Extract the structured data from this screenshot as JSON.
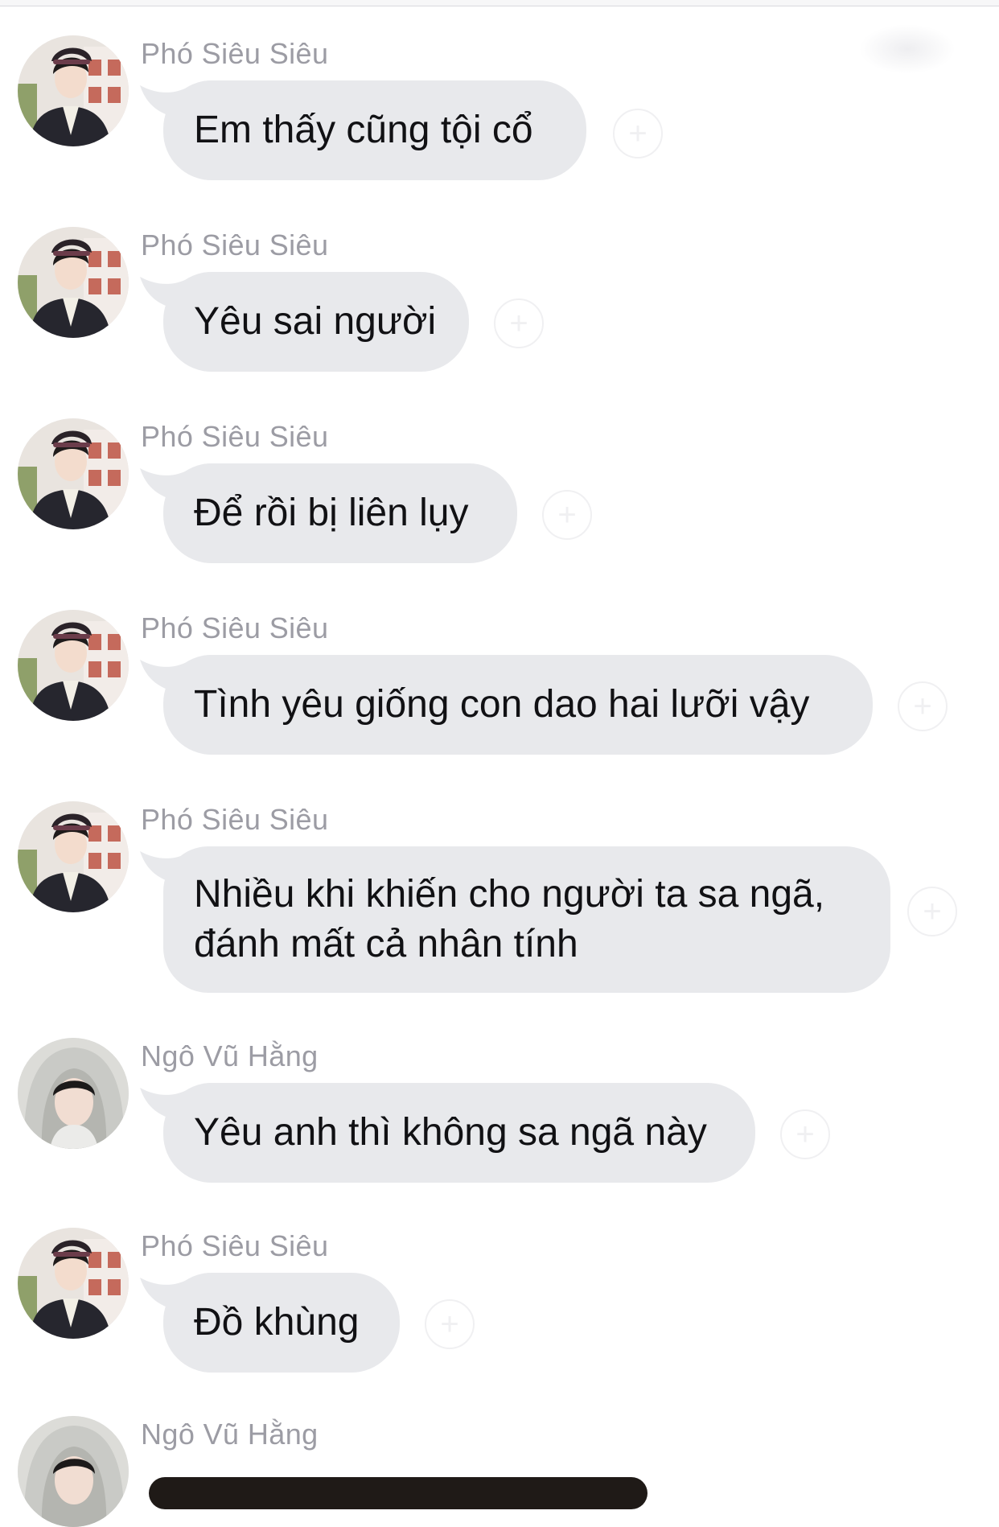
{
  "chat": {
    "messages": [
      {
        "sender": "Phó Siêu Siêu",
        "text": "Em thấy cũng tội cổ",
        "avatar_icon": "avatar-boy-cap-icon"
      },
      {
        "sender": "Phó Siêu Siêu",
        "text": "Yêu sai người",
        "avatar_icon": "avatar-boy-cap-icon"
      },
      {
        "sender": "Phó Siêu Siêu",
        "text": "Để rồi bị liên lụy",
        "avatar_icon": "avatar-boy-cap-icon"
      },
      {
        "sender": "Phó Siêu Siêu",
        "text": "Tình yêu giống con dao hai lưỡi vậy",
        "avatar_icon": "avatar-boy-cap-icon"
      },
      {
        "sender": "Phó Siêu Siêu",
        "text_lines": [
          "Nhiều khi khiến cho người ta sa ngã,",
          "đánh mất cả nhân tính"
        ],
        "avatar_icon": "avatar-boy-cap-icon"
      },
      {
        "sender": "Ngô Vũ Hằng",
        "text": "Yêu anh thì không sa ngã này",
        "avatar_icon": "avatar-boy-hood-icon"
      },
      {
        "sender": "Phó Siêu Siêu",
        "text": "Đồ khùng",
        "avatar_icon": "avatar-boy-cap-icon"
      },
      {
        "sender": "Ngô Vũ Hằng",
        "avatar_icon": "avatar-boy-hood-icon"
      }
    ],
    "react_icon": "add-reaction-icon",
    "react_symbol": "+"
  },
  "colors": {
    "background": "#ffffff",
    "bubble": "#e8e9ec",
    "sender_name": "#9c9ca4",
    "message_text": "#111114"
  }
}
